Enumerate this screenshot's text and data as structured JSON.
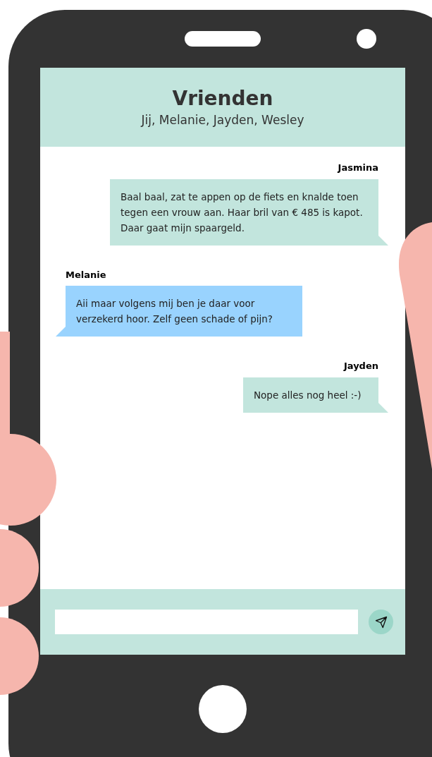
{
  "chat": {
    "title": "Vrienden",
    "members": "Jij, Melanie, Jayden, Wesley"
  },
  "messages": [
    {
      "sender": "Jasmina",
      "kind": "right",
      "text": "Baal baal, zat te appen op de fiets en knalde toen tegen een vrouw aan. Haar bril van € 485 is kapot. Daar gaat mijn spaargeld."
    },
    {
      "sender": "Melanie",
      "kind": "left",
      "text": "Aii maar volgens mij ben je daar voor verzekerd hoor. Zelf geen schade of pijn?"
    },
    {
      "sender": "Jayden",
      "kind": "right",
      "text": "Nope alles nog heel :-)"
    }
  ]
}
